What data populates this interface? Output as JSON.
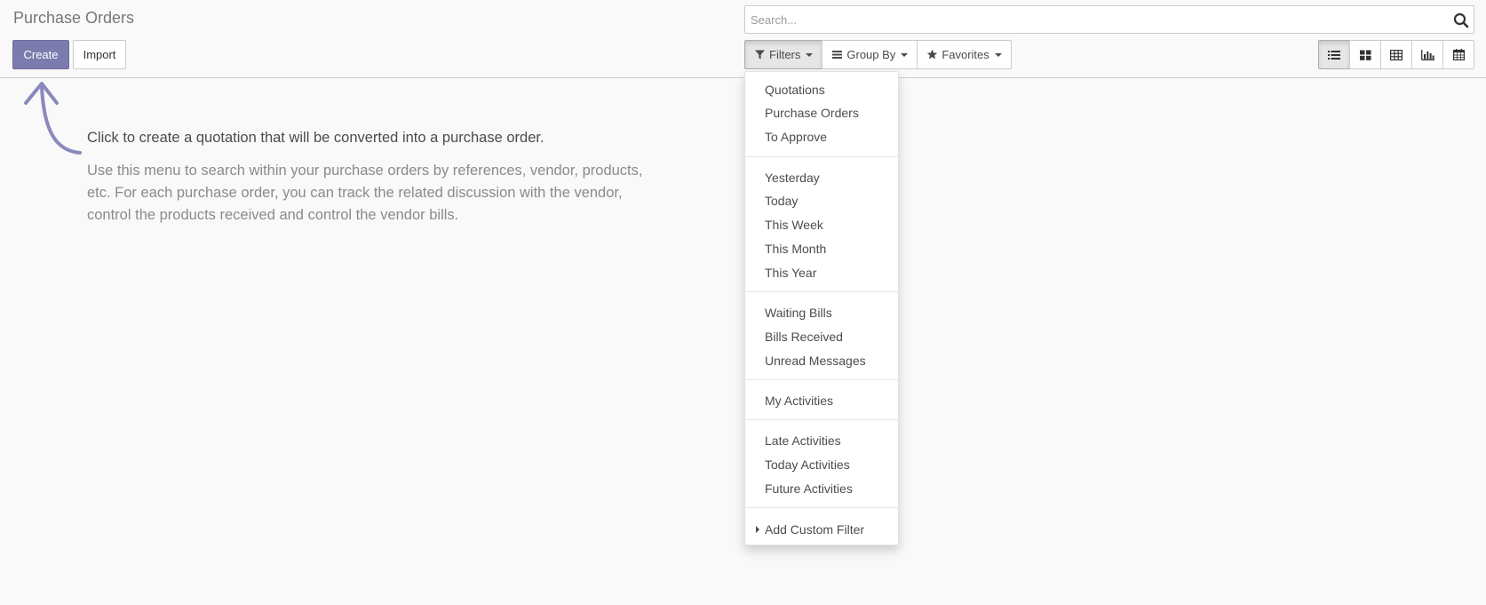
{
  "page": {
    "title": "Purchase Orders"
  },
  "buttons": {
    "create": "Create",
    "import": "Import"
  },
  "search": {
    "placeholder": "Search...",
    "value": ""
  },
  "search_options": {
    "filters": "Filters",
    "group_by": "Group By",
    "favorites": "Favorites"
  },
  "views": [
    "list",
    "kanban",
    "pivot",
    "graph",
    "calendar"
  ],
  "active_view": "list",
  "filters_menu": {
    "groups": [
      [
        "Quotations",
        "Purchase Orders",
        "To Approve"
      ],
      [
        "Yesterday",
        "Today",
        "This Week",
        "This Month",
        "This Year"
      ],
      [
        "Waiting Bills",
        "Bills Received",
        "Unread Messages"
      ],
      [
        "My Activities"
      ],
      [
        "Late Activities",
        "Today Activities",
        "Future Activities"
      ]
    ],
    "add_custom_filter": "Add Custom Filter"
  },
  "help": {
    "title": "Click to create a quotation that will be converted into a purchase order.",
    "body": "Use this menu to search within your purchase orders by references, vendor, products, etc. For each purchase order, you can track the related discussion with the vendor, control the products received and control the vendor bills."
  },
  "colors": {
    "primary": "#7c7bad",
    "background": "#f9f9f9",
    "text": "#4c4c4c"
  }
}
